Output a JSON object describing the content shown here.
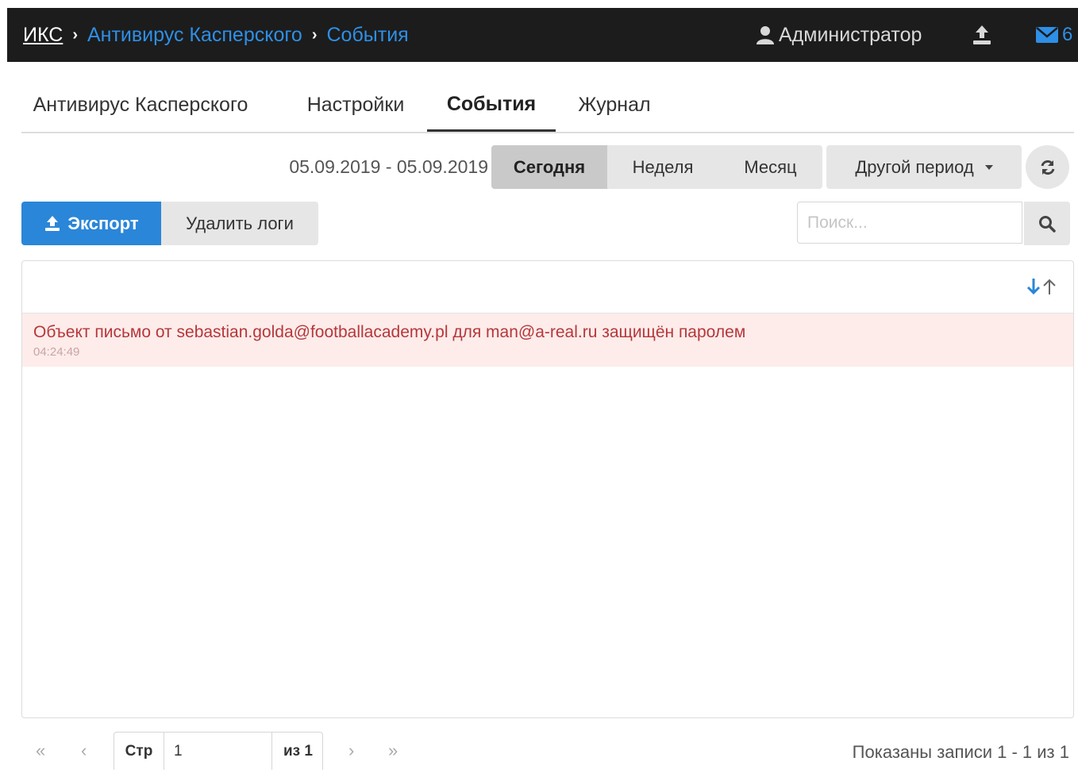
{
  "breadcrumb": {
    "root": "ИКС",
    "items": [
      "Антивирус Касперского",
      "События"
    ]
  },
  "header": {
    "user": "Администратор",
    "messages_count": "6"
  },
  "tabs": [
    "Антивирус Касперского",
    "Настройки",
    "События",
    "Журнал"
  ],
  "active_tab": "События",
  "filters": {
    "date_range": "05.09.2019 - 05.09.2019",
    "today": "Сегодня",
    "week": "Неделя",
    "month": "Месяц",
    "other_period": "Другой период",
    "active": "Сегодня"
  },
  "toolbar": {
    "export": "Экспорт",
    "delete_logs": "Удалить логи",
    "search_placeholder": "Поиск..."
  },
  "events": [
    {
      "message": "Объект письмо от sebastian.golda@footballacademy.pl для man@a-real.ru защищён паролем",
      "time": "04:24:49"
    }
  ],
  "pagination": {
    "page_label": "Стр",
    "page": "1",
    "of_label": "из 1",
    "summary": "Показаны записи 1 - 1 из 1"
  },
  "colors": {
    "accent": "#2a86d8",
    "error_text": "#b6373b",
    "error_bg": "#fdecea",
    "topbar": "#1c1c1c"
  }
}
